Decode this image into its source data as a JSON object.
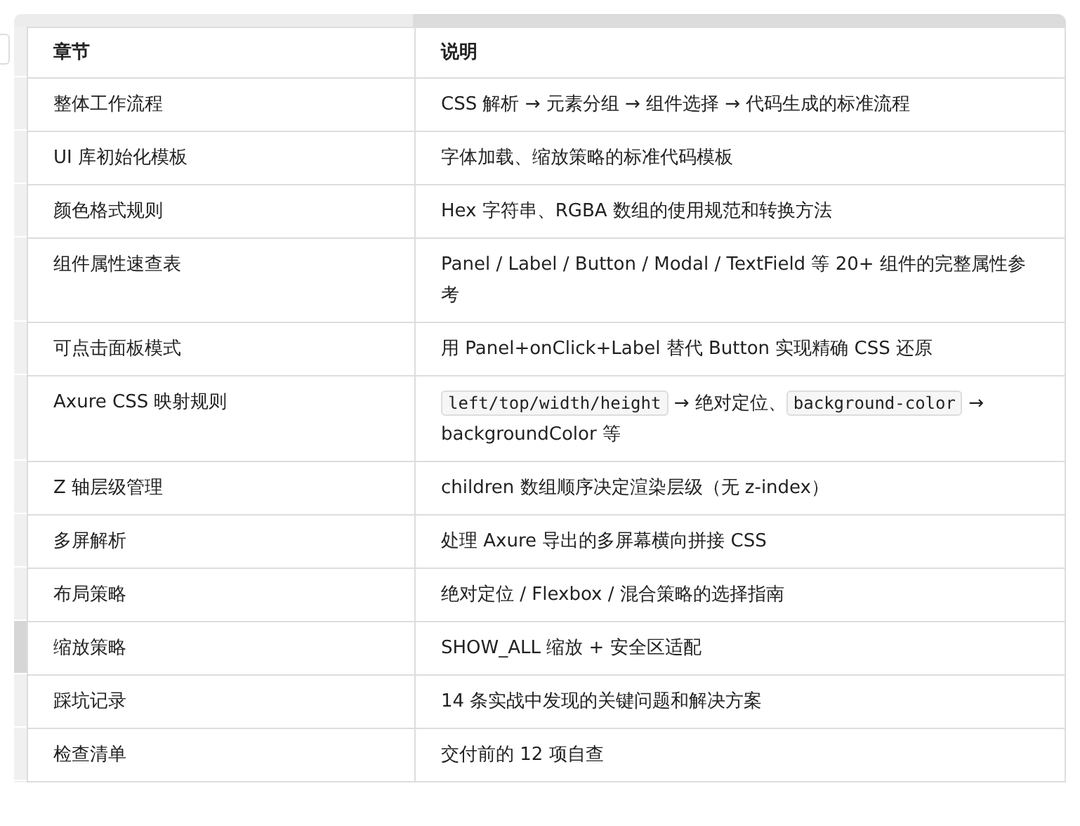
{
  "table": {
    "columns": [
      "章节",
      "说明"
    ],
    "rows": [
      {
        "selected": false,
        "chapter": "整体工作流程",
        "description": [
          {
            "kind": "text",
            "text": "CSS 解析 → 元素分组 → 组件选择 → 代码生成的标准流程"
          }
        ]
      },
      {
        "selected": false,
        "chapter": "UI 库初始化模板",
        "description": [
          {
            "kind": "text",
            "text": "字体加载、缩放策略的标准代码模板"
          }
        ]
      },
      {
        "selected": false,
        "chapter": "颜色格式规则",
        "description": [
          {
            "kind": "text",
            "text": "Hex 字符串、RGBA 数组的使用规范和转换方法"
          }
        ]
      },
      {
        "selected": false,
        "chapter": "组件属性速查表",
        "description": [
          {
            "kind": "text",
            "text": "Panel / Label / Button / Modal / TextField 等 20+ 组件的完整属性参考"
          }
        ]
      },
      {
        "selected": false,
        "chapter": "可点击面板模式",
        "description": [
          {
            "kind": "text",
            "text": "用 Panel+onClick+Label 替代 Button 实现精确 CSS 还原"
          }
        ]
      },
      {
        "selected": false,
        "chapter": "Axure CSS 映射规则",
        "description": [
          {
            "kind": "code",
            "text": "left/top/width/height"
          },
          {
            "kind": "text",
            "text": " → 绝对定位、"
          },
          {
            "kind": "code",
            "text": "background-color"
          },
          {
            "kind": "text",
            "text": " → backgroundColor 等"
          }
        ]
      },
      {
        "selected": false,
        "chapter": "Z 轴层级管理",
        "description": [
          {
            "kind": "text",
            "text": "children 数组顺序决定渲染层级（无 z-index）"
          }
        ]
      },
      {
        "selected": false,
        "chapter": "多屏解析",
        "description": [
          {
            "kind": "text",
            "text": "处理 Axure 导出的多屏幕横向拼接 CSS"
          }
        ]
      },
      {
        "selected": false,
        "chapter": "布局策略",
        "description": [
          {
            "kind": "text",
            "text": "绝对定位 / Flexbox / 混合策略的选择指南"
          }
        ]
      },
      {
        "selected": true,
        "chapter": "缩放策略",
        "description": [
          {
            "kind": "text",
            "text": "SHOW_ALL 缩放 + 安全区适配"
          }
        ]
      },
      {
        "selected": false,
        "chapter": "踩坑记录",
        "description": [
          {
            "kind": "text",
            "text": "14 条实战中发现的关键问题和解决方案"
          }
        ]
      },
      {
        "selected": false,
        "chapter": "检查清单",
        "description": [
          {
            "kind": "text",
            "text": "交付前的 12 项自查"
          }
        ]
      }
    ]
  }
}
